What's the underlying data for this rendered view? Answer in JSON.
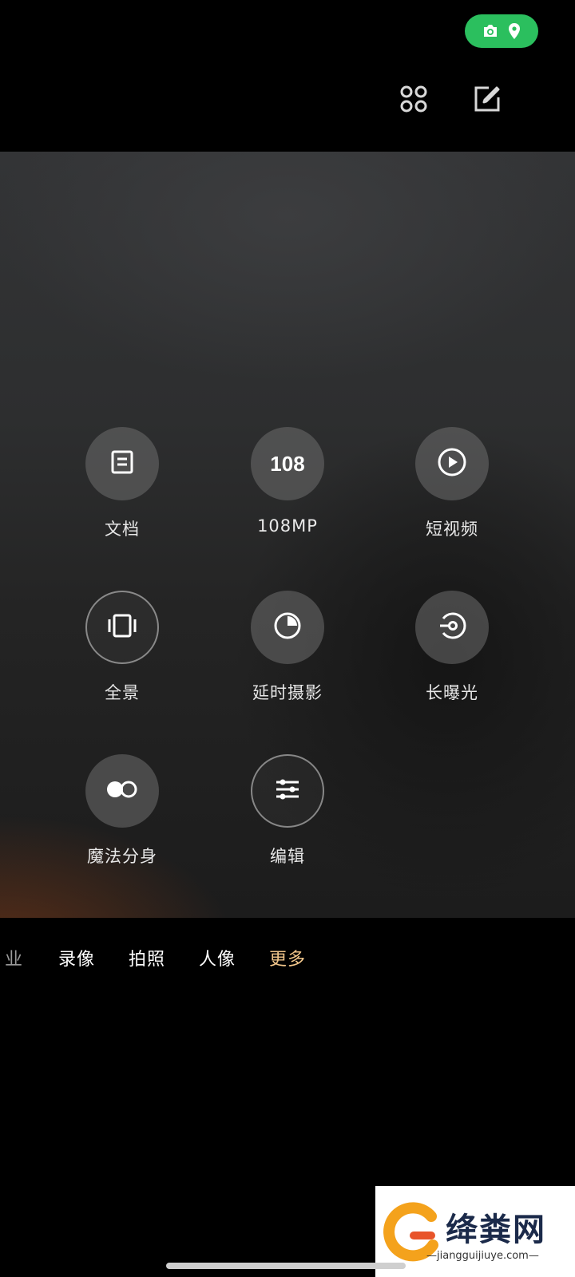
{
  "status": {
    "pill_color": "#2bbf5e",
    "icons": [
      "camera-icon",
      "location-pin-icon"
    ]
  },
  "toolbar": {
    "icons": [
      "grid-icon",
      "edit-icon"
    ]
  },
  "modes": [
    {
      "label": "文档",
      "icon": "document-icon"
    },
    {
      "label": "108MP",
      "icon": "108",
      "icon_text": "108"
    },
    {
      "label": "短视频",
      "icon": "play-icon"
    },
    {
      "label": "全景",
      "icon": "panorama-icon"
    },
    {
      "label": "延时摄影",
      "icon": "timelapse-icon"
    },
    {
      "label": "长曝光",
      "icon": "long-exposure-icon"
    },
    {
      "label": "魔法分身",
      "icon": "clone-icon"
    },
    {
      "label": "编辑",
      "icon": "sliders-icon"
    }
  ],
  "mode_bar": {
    "tabs": [
      {
        "label": "业",
        "state": "partial"
      },
      {
        "label": "录像",
        "state": "normal"
      },
      {
        "label": "拍照",
        "state": "normal"
      },
      {
        "label": "人像",
        "state": "normal"
      },
      {
        "label": "更多",
        "state": "active"
      }
    ],
    "active_color": "#f0c58a"
  },
  "watermark": {
    "title": "绛粪网",
    "url": "—jiangguijiuye.com—"
  }
}
